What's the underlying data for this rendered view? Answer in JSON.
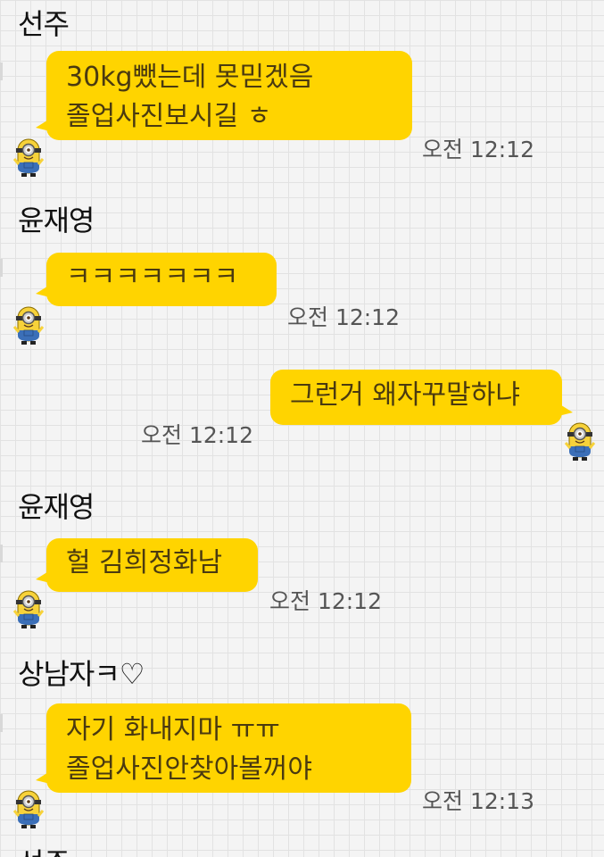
{
  "messages": [
    {
      "sender": "선주",
      "lines": [
        "30kg뺐는데 못믿겠음",
        "졸업사진보시길 ㅎ"
      ],
      "time": "오전 12:12"
    },
    {
      "sender": "윤재영",
      "lines": [
        "ㅋㅋㅋㅋㅋㅋㅋ"
      ],
      "time": "오전 12:12"
    },
    {
      "sender": "",
      "lines": [
        "그런거 왜자꾸말하냐"
      ],
      "time": "오전 12:12"
    },
    {
      "sender": "윤재영",
      "lines": [
        "헐 김희정화남"
      ],
      "time": "오전 12:12"
    },
    {
      "sender": "상남자ㅋ♡",
      "lines": [
        "자기 화내지마 ㅠㅠ",
        "졸업사진안찾아볼꺼야"
      ],
      "time": "오전 12:13"
    },
    {
      "sender": "선주"
    }
  ],
  "colors": {
    "bubble": "#ffd400",
    "background": "#f4f4f4",
    "grid": "#e2e2e2"
  },
  "icons": {
    "avatar": "minion-avatar-icon"
  }
}
